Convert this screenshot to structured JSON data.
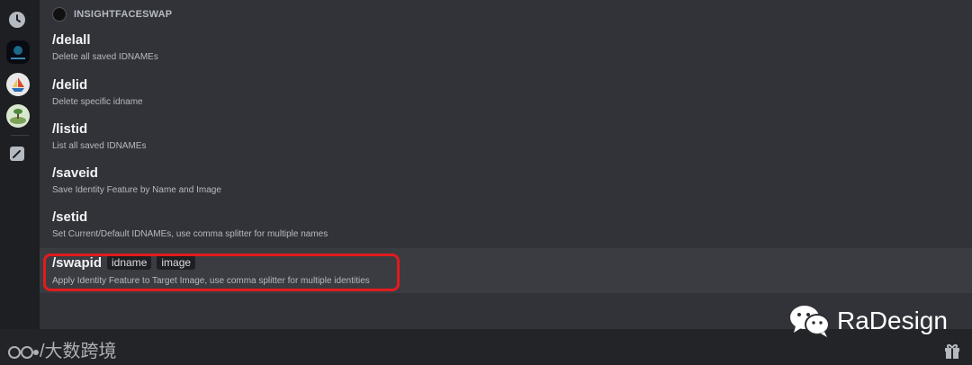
{
  "bot": {
    "name": "INSIGHTFACESWAP"
  },
  "commands": [
    {
      "name": "/delall",
      "desc": "Delete all saved IDNAMEs"
    },
    {
      "name": "/delid",
      "desc": "Delete specific idname"
    },
    {
      "name": "/listid",
      "desc": "List all saved IDNAMEs"
    },
    {
      "name": "/saveid",
      "desc": "Save Identity Feature by Name and Image"
    },
    {
      "name": "/setid",
      "desc": "Set Current/Default IDNAMEs, use comma splitter for multiple names"
    },
    {
      "name": "/swapid",
      "desc": "Apply Identity Feature to Target Image, use comma splitter for multiple identities",
      "options": [
        "idname",
        "image"
      ]
    }
  ],
  "watermarks": {
    "left": "/大数跨境",
    "right": "RaDesign"
  },
  "icons": [
    "clock-icon",
    "server-icon-insightface",
    "server-icon-boat",
    "server-icon-island",
    "edit-icon",
    "gift-icon",
    "wechat-icon"
  ],
  "colors": {
    "highlight_border": "#e21b1b",
    "bg": "#313338",
    "rail": "#1e1f22"
  }
}
